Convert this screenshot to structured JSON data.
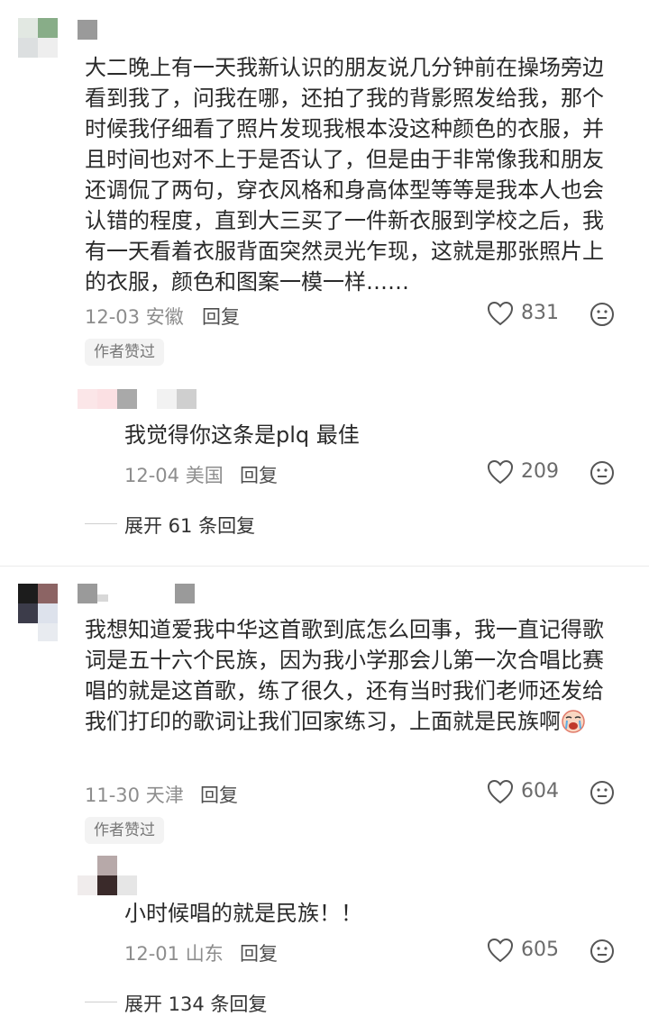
{
  "comments": [
    {
      "text": "大二晚上有一天我新认识的朋友说几分钟前在操场旁边看到我了，问我在哪，还拍了我的背影照发给我，那个时候我仔细看了照片发现我根本没这种颜色的衣服，并且时间也对不上于是否认了，但是由于非常像我和朋友还调侃了两句，穿衣风格和身高体型等等是我本人也会认错的程度，直到大三买了一件新衣服到学校之后，我有一天看着衣服背面突然灵光乍现，这就是那张照片上的衣服，颜色和图案一模一样……",
      "date": "12-03",
      "location": "安徽",
      "reply_label": "回复",
      "likes": "831",
      "badge": "作者赞过",
      "reply": {
        "text": "我觉得你这条是plq 最佳",
        "date": "12-04",
        "location": "美国",
        "reply_label": "回复",
        "likes": "209"
      },
      "expand_label": "展开 61 条回复"
    },
    {
      "text": "我想知道爱我中华这首歌到底怎么回事，我一直记得歌词是五十六个民族，因为我小学那会儿第一次合唱比赛唱的就是这首歌，练了很久，还有当时我们老师还发给我们打印的歌词让我们回家练习，上面就是民族啊",
      "date": "11-30",
      "location": "天津",
      "reply_label": "回复",
      "likes": "604",
      "badge": "作者赞过",
      "reply": {
        "text": "小时候唱的就是民族！！",
        "date": "12-01",
        "location": "山东",
        "reply_label": "回复",
        "likes": "605"
      },
      "expand_label": "展开 134 条回复"
    }
  ],
  "icons": {
    "like": "heart-outline-icon",
    "dislike": "neutral-face-icon",
    "emoji": "crying-face-emoji"
  },
  "colors": {
    "text": "#2a2a2a",
    "meta": "#8d8d8d",
    "badge_bg": "#f3f3f3"
  }
}
